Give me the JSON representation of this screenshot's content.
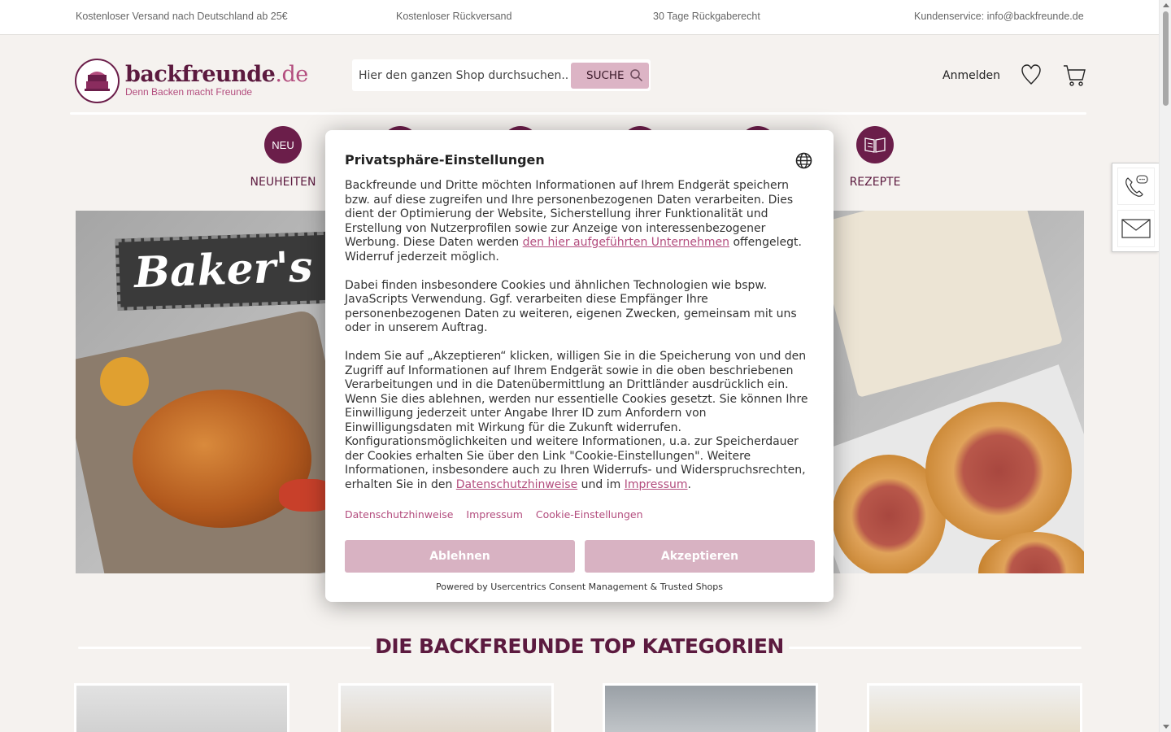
{
  "topbar": {
    "shipping": "Kostenloser Versand nach Deutschland ab 25€",
    "returns": "Kostenloser Rückversand",
    "return_policy": "30 Tage Rückgaberecht",
    "service": "Kundenservice: info@backfreunde.de"
  },
  "header": {
    "logo_name": "backfreunde",
    "logo_tld": ".de",
    "logo_tagline": "Denn Backen macht Freunde",
    "search_placeholder": "Hier den ganzen Shop durchsuchen...",
    "search_button": "SUCHE",
    "login": "Anmelden",
    "wishlist_icon": "heart-icon",
    "cart_icon": "cart-icon"
  },
  "nav": {
    "items": [
      {
        "label": "NEUHEITEN",
        "icon_text": "NEU"
      },
      {
        "label": "REZEPTE",
        "icon_text": ""
      }
    ]
  },
  "hero": {
    "banner_text": "Baker's BE"
  },
  "section": {
    "title": "DIE BACKFREUNDE TOP KATEGORIEN"
  },
  "side_widget": {
    "phone_icon": "phone-chat-icon",
    "mail_icon": "mail-icon"
  },
  "consent": {
    "title": "Privatsphäre-Einstellungen",
    "p1_before": "Backfreunde und Dritte möchten Informationen auf Ihrem Endgerät speichern bzw. auf diese zugreifen und Ihre personenbezogenen Daten verarbeiten. Dies dient der Optimierung der Website, Sicherstellung ihrer Funktionalität und Erstellung von Nutzerprofilen sowie zur Anzeige von interessenbezogener Werbung. Diese Daten werden ",
    "p1_link": "den hier aufgeführten Unternehmen",
    "p1_after": " offengelegt. Widerruf jederzeit möglich.",
    "p2": "Dabei finden insbesondere Cookies und ähnlichen Technologien wie bspw. JavaScripts Verwendung. Ggf. verarbeiten diese Empfänger Ihre personenbezogenen Daten zu weiteren, eigenen Zwecken, gemeinsam mit uns oder in unserem Auftrag.",
    "p3_before": "Indem Sie auf „Akzeptieren“ klicken, willigen Sie in die Speicherung von und den Zugriff auf Informationen auf Ihrem Endgerät sowie in die oben beschriebenen Verarbeitungen und in die Datenübermittlung an Drittländer ausdrücklich ein. Wenn Sie dies ablehnen, werden nur essentielle Cookies gesetzt. Sie können Ihre Einwilligung jederzeit unter Angabe Ihrer ID zum Anfordern von Einwilligungsdaten mit Wirkung für die Zukunft widerrufen. Konfigurationsmöglichkeiten und weitere Informationen, u.a. zur Speicherdauer der Cookies erhalten Sie über den Link \"Cookie-Einstellungen\". Weitere Informationen, insbesondere auch zu Ihren Widerrufs- und Widerspruchsrechten, erhalten Sie in den ",
    "p3_link1": "Datenschutzhinweise",
    "p3_mid": " und im ",
    "p3_link2": "Impressum",
    "p3_end": ".",
    "links": [
      "Datenschutzhinweise",
      "Impressum",
      "Cookie-Einstellungen"
    ],
    "deny_button": "Ablehnen",
    "accept_button": "Akzeptieren",
    "powered_by": "Powered by Usercentrics Consent Management & Trusted Shops"
  },
  "colors": {
    "brand": "#5c1a3f",
    "accent": "#b34d7e",
    "button": "#d8b2c2",
    "background": "#f5f2ef"
  }
}
